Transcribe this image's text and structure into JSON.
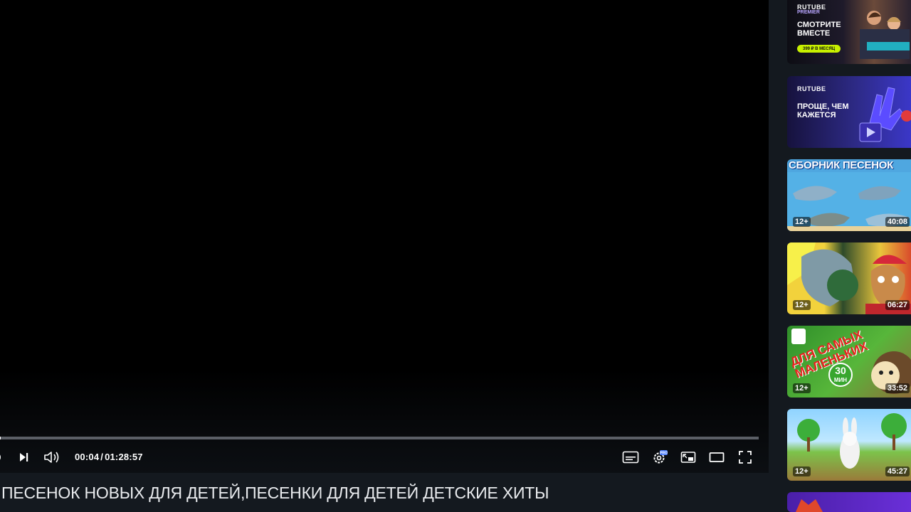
{
  "player": {
    "progress_fraction": 0.0008,
    "current_time": "00:04",
    "separator": "/",
    "total_time": "01:28:57"
  },
  "video": {
    "title": "ПЕСЕНОК НОВЫХ ДЛЯ ДЕТЕЙ,ПЕСЕНКИ ДЛЯ ДЕТЕЙ ДЕТСКИЕ ХИТЫ"
  },
  "sidebar": {
    "promos": [
      {
        "brand": "RUTUBE",
        "sub": "PREMIER",
        "headline_1": "СМОТРИТЕ",
        "headline_2": "ВМЕСТЕ",
        "price": "399 ₽ В МЕСЯЦ"
      },
      {
        "brand": "RUTUBE",
        "headline_1": "ПРОЩЕ, ЧЕМ",
        "headline_2": "КАЖЕТСЯ"
      }
    ],
    "videos": [
      {
        "headline": "СБОРНИК ПЕСЕНОК",
        "age": "12+",
        "duration": "40:08"
      },
      {
        "age": "12+",
        "duration": "06:27"
      },
      {
        "headline_1": "ДЛЯ САМЫХ",
        "headline_2": "МАЛЕНЬКИХ",
        "circle_num": "30",
        "circle_unit": "МИН",
        "age": "12+",
        "duration": "33:52"
      },
      {
        "age": "12+",
        "duration": "45:27"
      }
    ]
  },
  "colors": {
    "background": "#14191f",
    "accent_lime": "#c8f000"
  }
}
